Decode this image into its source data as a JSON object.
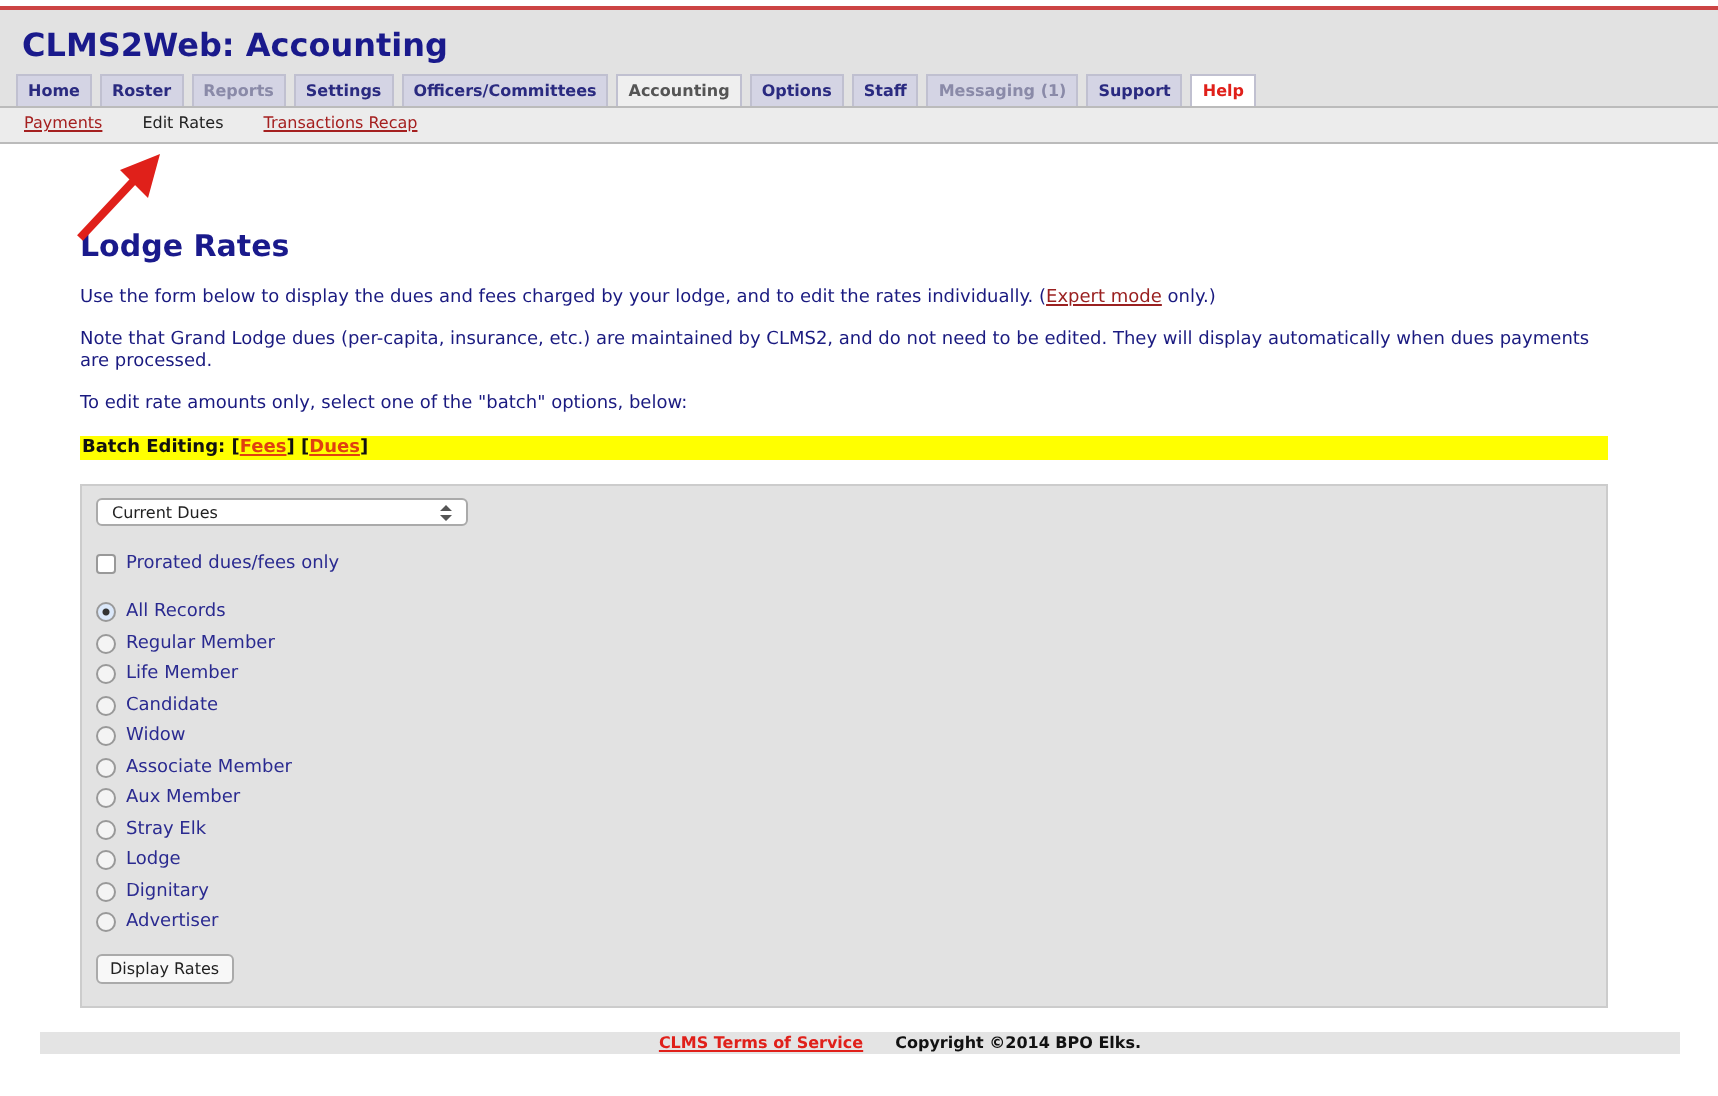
{
  "app_title": "CLMS2Web: Accounting",
  "tabs": [
    {
      "label": "Home",
      "selected": false,
      "disabled": false,
      "kind": "normal"
    },
    {
      "label": "Roster",
      "selected": false,
      "disabled": false,
      "kind": "normal"
    },
    {
      "label": "Reports",
      "selected": false,
      "disabled": true,
      "kind": "normal"
    },
    {
      "label": "Settings",
      "selected": false,
      "disabled": false,
      "kind": "normal"
    },
    {
      "label": "Officers/Committees",
      "selected": false,
      "disabled": false,
      "kind": "normal"
    },
    {
      "label": "Accounting",
      "selected": true,
      "disabled": false,
      "kind": "normal"
    },
    {
      "label": "Options",
      "selected": false,
      "disabled": false,
      "kind": "normal"
    },
    {
      "label": "Staff",
      "selected": false,
      "disabled": false,
      "kind": "normal"
    },
    {
      "label": "Messaging (1)",
      "selected": false,
      "disabled": true,
      "kind": "normal"
    },
    {
      "label": "Support",
      "selected": false,
      "disabled": false,
      "kind": "normal"
    },
    {
      "label": "Help",
      "selected": false,
      "disabled": false,
      "kind": "help"
    }
  ],
  "subnav": [
    {
      "label": "Payments",
      "selected": false
    },
    {
      "label": "Edit Rates",
      "selected": true
    },
    {
      "label": "Transactions Recap",
      "selected": false
    }
  ],
  "heading": "Lodge Rates",
  "paragraphs": [
    [
      {
        "kind": "text",
        "text": "Use the form below to display the dues and fees charged by your lodge, and to edit the rates individually. ("
      },
      {
        "kind": "link",
        "text": "Expert mode"
      },
      {
        "kind": "text",
        "text": " only.)"
      }
    ],
    [
      {
        "kind": "text",
        "text": "Note that Grand Lodge dues (per-capita, insurance, etc.) are maintained by CLMS2, and do not need to be edited. They will display automatically when dues payments are processed."
      }
    ],
    [
      {
        "kind": "text",
        "text": "To edit rate amounts only, select one of the \"batch\" options, below:"
      }
    ]
  ],
  "batch_bar": [
    {
      "kind": "text",
      "text": "Batch Editing: ["
    },
    {
      "kind": "link",
      "text": "Fees"
    },
    {
      "kind": "text",
      "text": "] ["
    },
    {
      "kind": "link",
      "text": "Dues"
    },
    {
      "kind": "text",
      "text": "]"
    }
  ],
  "form": {
    "dropdown": {
      "value": "Current Dues"
    },
    "prorated": {
      "label": "Prorated dues/fees only",
      "checked": false
    },
    "record_types": [
      {
        "label": "All Records",
        "selected": true
      },
      {
        "label": "Regular Member",
        "selected": false
      },
      {
        "label": "Life Member",
        "selected": false
      },
      {
        "label": "Candidate",
        "selected": false
      },
      {
        "label": "Widow",
        "selected": false
      },
      {
        "label": "Associate Member",
        "selected": false
      },
      {
        "label": "Aux Member",
        "selected": false
      },
      {
        "label": "Stray Elk",
        "selected": false
      },
      {
        "label": "Lodge",
        "selected": false
      },
      {
        "label": "Dignitary",
        "selected": false
      },
      {
        "label": "Advertiser",
        "selected": false
      }
    ],
    "button": "Display Rates"
  },
  "footer": {
    "link": "CLMS Terms of Service",
    "copyright": "Copyright ©2014 BPO Elks."
  }
}
